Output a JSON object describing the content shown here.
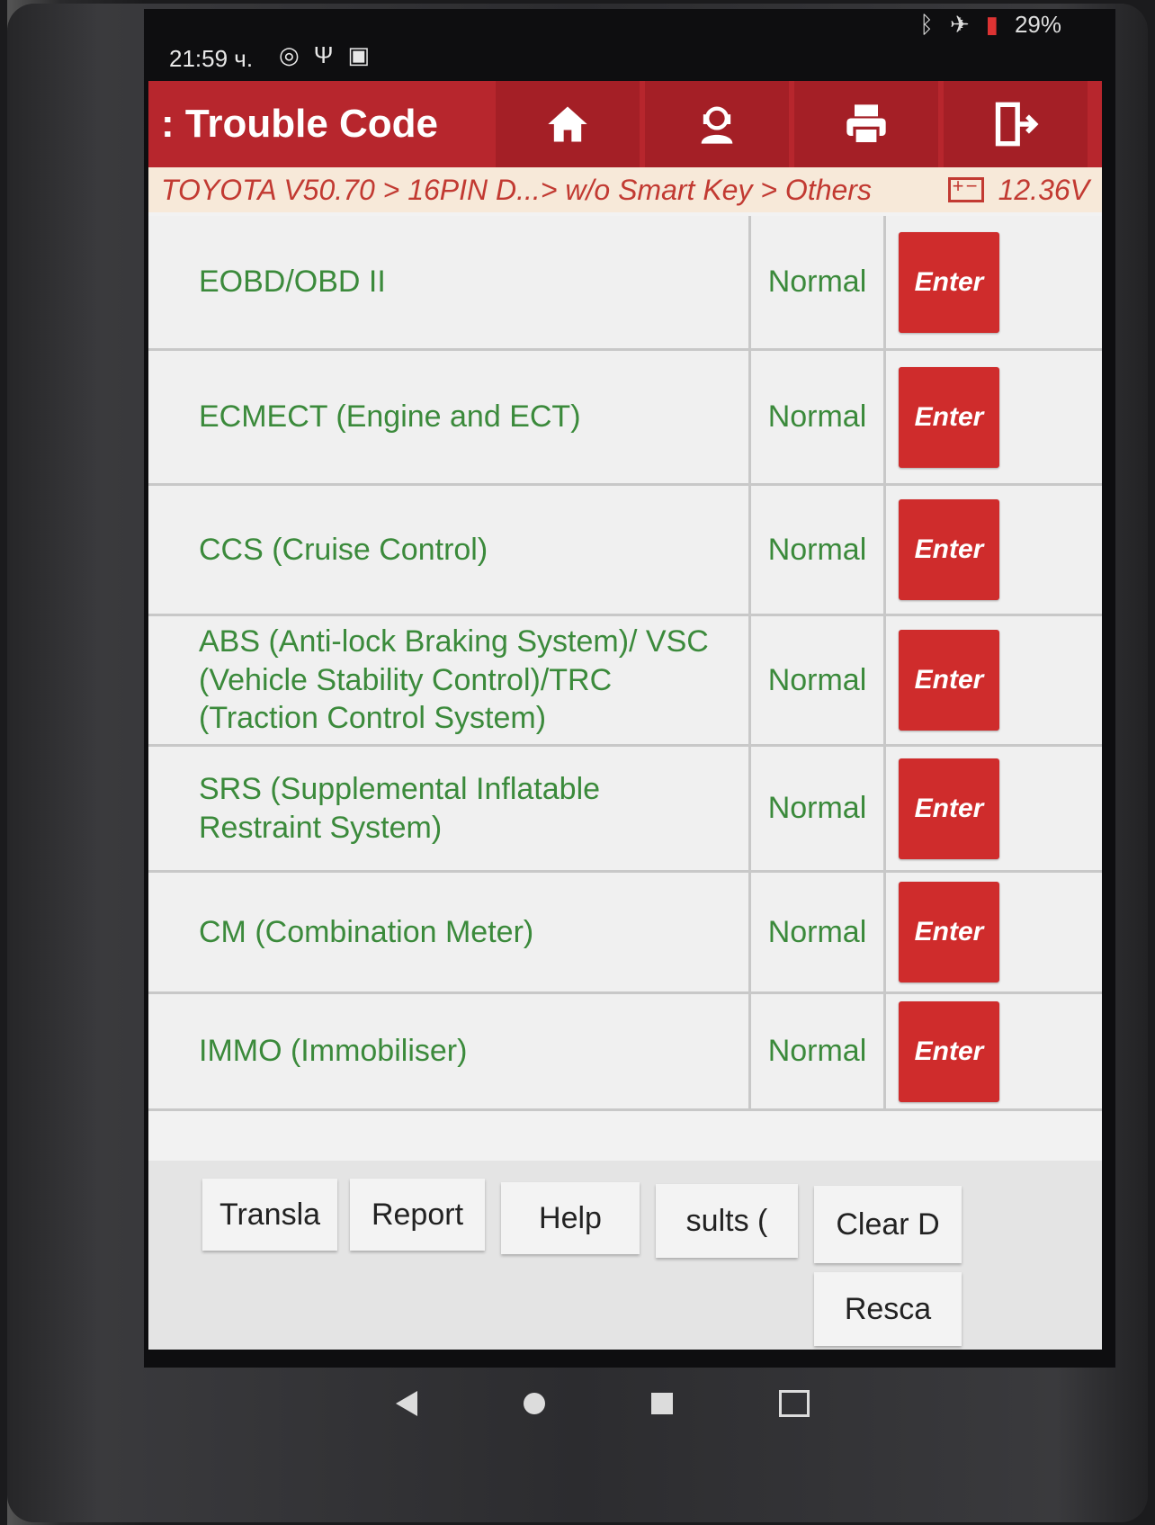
{
  "status_bar": {
    "time": "21:59 ч.",
    "battery": "29%"
  },
  "header": {
    "title": "Trouble Code",
    "back_glyph": ":",
    "icons": [
      "home-icon",
      "support-icon",
      "print-icon",
      "exit-icon"
    ]
  },
  "breadcrumb": {
    "path": "TOYOTA V50.70 > 16PIN D...> w/o Smart Key > Others",
    "voltage": "12.36V"
  },
  "systems": [
    {
      "name": "EOBD/OBD II",
      "status": "Normal",
      "action": "Enter"
    },
    {
      "name": "ECMECT (Engine and ECT)",
      "status": "Normal",
      "action": "Enter"
    },
    {
      "name": "CCS (Cruise Control)",
      "status": "Normal",
      "action": "Enter"
    },
    {
      "name": "ABS (Anti-lock Braking System)/ VSC (Vehicle Stability Control)/TRC (Traction Control System)",
      "status": "Normal",
      "action": "Enter"
    },
    {
      "name": "SRS (Supplemental Inflatable Restraint System)",
      "status": "Normal",
      "action": "Enter"
    },
    {
      "name": "CM (Combination Meter)",
      "status": "Normal",
      "action": "Enter"
    },
    {
      "name": "IMMO (Immobiliser)",
      "status": "Normal",
      "action": "Enter"
    }
  ],
  "bottom_buttons": {
    "translate": "Transla",
    "report": "Report",
    "help": "Help",
    "results": "sults   (",
    "clear": "Clear D",
    "rescan": "Resca"
  },
  "colors": {
    "header_red": "#b7262d",
    "enter_red": "#cf2c2c",
    "status_green": "#3b8a3b",
    "breadcrumb_text": "#c23a32"
  }
}
